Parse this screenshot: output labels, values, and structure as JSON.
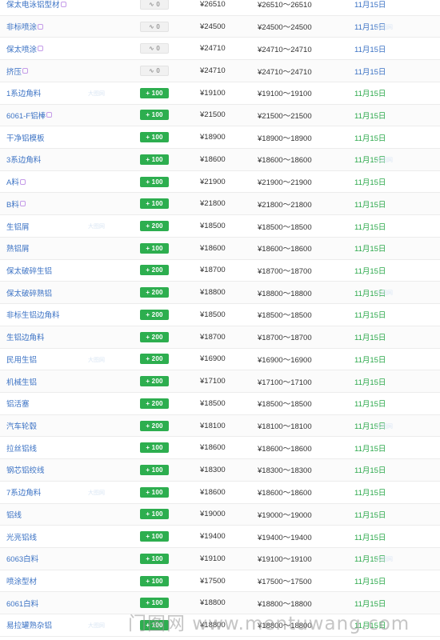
{
  "colors": {
    "link": "#3b72c4",
    "up_badge": "#2dae4f",
    "up_date": "#2aa84a",
    "flat_badge_bg": "#f1f1f1"
  },
  "watermark": {
    "text": "门图网 www.mentuwang.com",
    "mini_text": "大图网"
  },
  "rows": [
    {
      "name": "保太电泳铝型材",
      "change": "0",
      "dir": "flat",
      "price": "¥26510",
      "range": "¥26510～26510",
      "date": "11月15日"
    },
    {
      "name": "非标喷涂",
      "change": "0",
      "dir": "flat",
      "price": "¥24500",
      "range": "¥24500～24500",
      "date": "11月15日"
    },
    {
      "name": "保太喷涂",
      "change": "0",
      "dir": "flat",
      "price": "¥24710",
      "range": "¥24710～24710",
      "date": "11月15日"
    },
    {
      "name": "挤压",
      "change": "0",
      "dir": "flat",
      "price": "¥24710",
      "range": "¥24710～24710",
      "date": "11月15日"
    },
    {
      "name": "1系边角料",
      "change": "100",
      "dir": "up",
      "price": "¥19100",
      "range": "¥19100～19100",
      "date": "11月15日"
    },
    {
      "name": "6061-F铝棒",
      "change": "100",
      "dir": "up",
      "price": "¥21500",
      "range": "¥21500～21500",
      "date": "11月15日"
    },
    {
      "name": "干净铝模板",
      "change": "100",
      "dir": "up",
      "price": "¥18900",
      "range": "¥18900～18900",
      "date": "11月15日"
    },
    {
      "name": "3系边角料",
      "change": "100",
      "dir": "up",
      "price": "¥18600",
      "range": "¥18600～18600",
      "date": "11月15日"
    },
    {
      "name": "A料",
      "change": "100",
      "dir": "up",
      "price": "¥21900",
      "range": "¥21900～21900",
      "date": "11月15日"
    },
    {
      "name": "B料",
      "change": "100",
      "dir": "up",
      "price": "¥21800",
      "range": "¥21800～21800",
      "date": "11月15日"
    },
    {
      "name": "生铝屑",
      "change": "200",
      "dir": "up",
      "price": "¥18500",
      "range": "¥18500～18500",
      "date": "11月15日"
    },
    {
      "name": "熟铝屑",
      "change": "100",
      "dir": "up",
      "price": "¥18600",
      "range": "¥18600～18600",
      "date": "11月15日"
    },
    {
      "name": "保太破碎生铝",
      "change": "200",
      "dir": "up",
      "price": "¥18700",
      "range": "¥18700～18700",
      "date": "11月15日"
    },
    {
      "name": "保太破碎熟铝",
      "change": "200",
      "dir": "up",
      "price": "¥18800",
      "range": "¥18800～18800",
      "date": "11月15日"
    },
    {
      "name": "非标生铝边角料",
      "change": "200",
      "dir": "up",
      "price": "¥18500",
      "range": "¥18500～18500",
      "date": "11月15日"
    },
    {
      "name": "生铝边角料",
      "change": "200",
      "dir": "up",
      "price": "¥18700",
      "range": "¥18700～18700",
      "date": "11月15日"
    },
    {
      "name": "民用生铝",
      "change": "200",
      "dir": "up",
      "price": "¥16900",
      "range": "¥16900～16900",
      "date": "11月15日"
    },
    {
      "name": "机械生铝",
      "change": "200",
      "dir": "up",
      "price": "¥17100",
      "range": "¥17100～17100",
      "date": "11月15日"
    },
    {
      "name": "铝活塞",
      "change": "200",
      "dir": "up",
      "price": "¥18500",
      "range": "¥18500～18500",
      "date": "11月15日"
    },
    {
      "name": "汽车轮毂",
      "change": "200",
      "dir": "up",
      "price": "¥18100",
      "range": "¥18100～18100",
      "date": "11月15日"
    },
    {
      "name": "拉丝铝线",
      "change": "100",
      "dir": "up",
      "price": "¥18600",
      "range": "¥18600～18600",
      "date": "11月15日"
    },
    {
      "name": "钢芯铝绞线",
      "change": "100",
      "dir": "up",
      "price": "¥18300",
      "range": "¥18300～18300",
      "date": "11月15日"
    },
    {
      "name": "7系边角料",
      "change": "100",
      "dir": "up",
      "price": "¥18600",
      "range": "¥18600～18600",
      "date": "11月15日"
    },
    {
      "name": "铝线",
      "change": "100",
      "dir": "up",
      "price": "¥19000",
      "range": "¥19000～19000",
      "date": "11月15日"
    },
    {
      "name": "光亮铝线",
      "change": "100",
      "dir": "up",
      "price": "¥19400",
      "range": "¥19400～19400",
      "date": "11月15日"
    },
    {
      "name": "6063白料",
      "change": "100",
      "dir": "up",
      "price": "¥19100",
      "range": "¥19100～19100",
      "date": "11月15日"
    },
    {
      "name": "喷涂型材",
      "change": "100",
      "dir": "up",
      "price": "¥17500",
      "range": "¥17500～17500",
      "date": "11月15日"
    },
    {
      "name": "6061白料",
      "change": "100",
      "dir": "up",
      "price": "¥18800",
      "range": "¥18800～18800",
      "date": "11月15日"
    },
    {
      "name": "易拉罐熟杂铝",
      "change": "100",
      "dir": "up",
      "price": "¥18800",
      "range": "¥18800～18800",
      "date": "11月15日"
    }
  ]
}
